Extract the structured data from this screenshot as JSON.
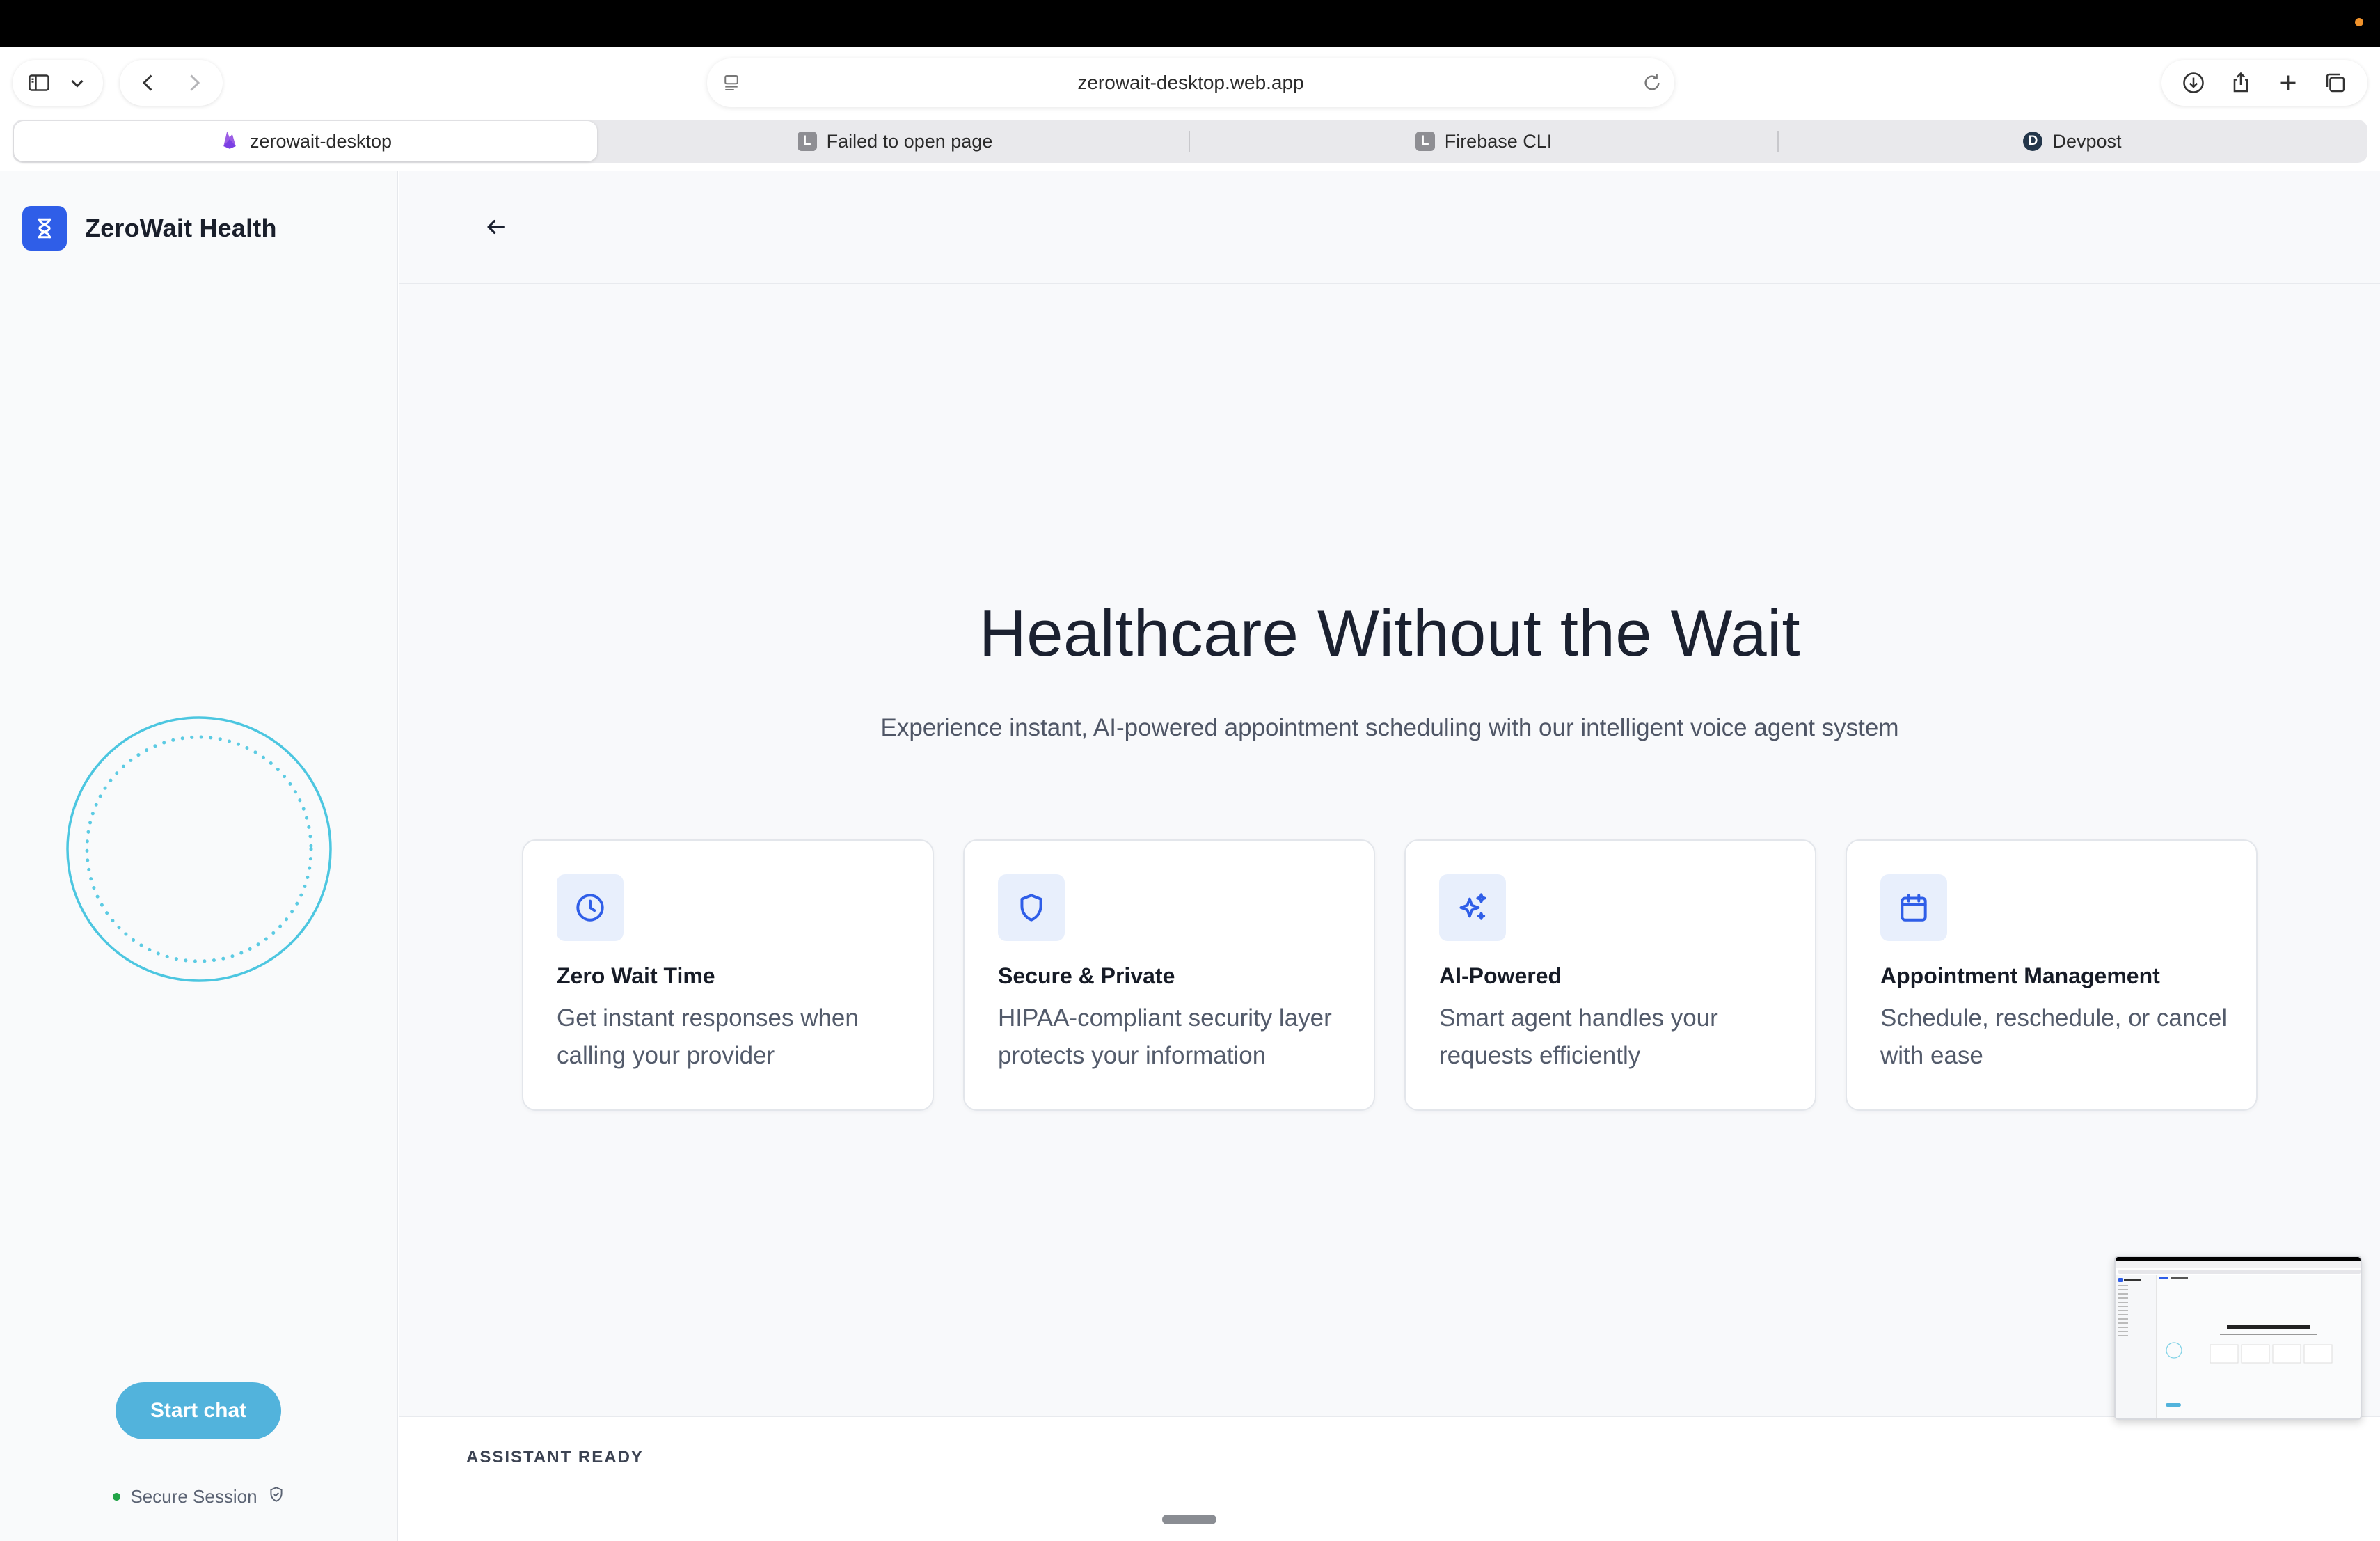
{
  "browser": {
    "url": "zerowait-desktop.web.app",
    "tabs": [
      {
        "label": "zerowait-desktop",
        "icon": "firebase-icon",
        "active": true
      },
      {
        "label": "Failed to open page",
        "icon": "letter-l-icon",
        "badge": "L"
      },
      {
        "label": "Firebase CLI",
        "icon": "letter-l-icon",
        "badge": "L"
      },
      {
        "label": "Devpost",
        "icon": "devpost-icon",
        "badge": "D"
      }
    ]
  },
  "sidebar": {
    "brand_name": "ZeroWait Health",
    "start_chat_label": "Start chat",
    "secure_label": "Secure Session"
  },
  "main": {
    "title": "Healthcare Without the Wait",
    "subtitle": "Experience instant, AI-powered appointment scheduling with our intelligent voice agent system",
    "features": [
      {
        "icon": "clock-icon",
        "title": "Zero Wait Time",
        "description": "Get instant responses when calling your provider"
      },
      {
        "icon": "shield-icon",
        "title": "Secure & Private",
        "description": "HIPAA-compliant security layer protects your information"
      },
      {
        "icon": "sparkles-icon",
        "title": "AI-Powered",
        "description": "Smart agent handles your requests efficiently"
      },
      {
        "icon": "calendar-icon",
        "title": "Appointment Management",
        "description": "Schedule, reschedule, or cancel with ease"
      }
    ],
    "status": "ASSISTANT READY"
  },
  "colors": {
    "brand": "#2f5ee8",
    "accent": "#52b3dc",
    "orb": "#4cc6e0",
    "secure_dot": "#22a447"
  }
}
